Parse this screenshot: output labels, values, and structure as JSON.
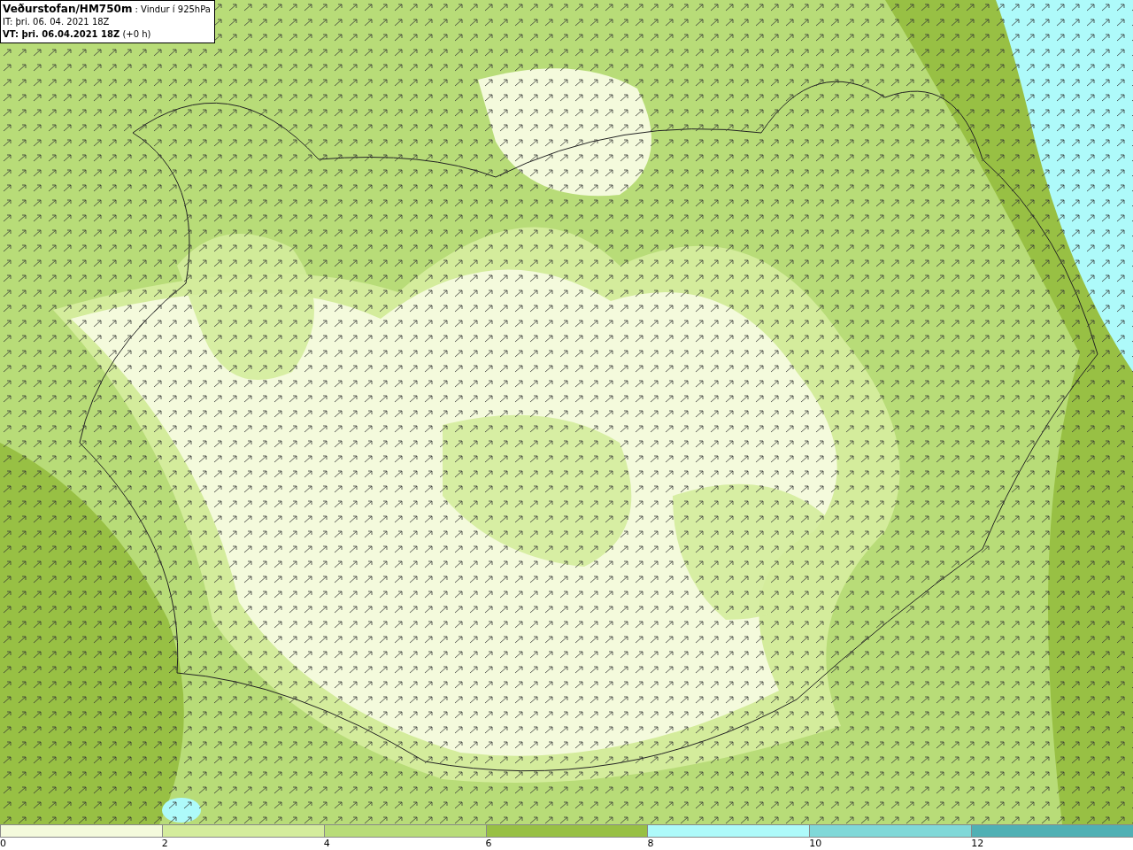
{
  "header": {
    "title": "**Veðurstofan/HM750m** : Vindur í 925hPa",
    "initial_time": "IT: þri. 06. 04. 2021 18Z",
    "valid_time": "**VT: þri. 06.04.2021 18Z** (+0 h)"
  },
  "legend": {
    "bins": [
      {
        "label": "0",
        "color": "#f4fadc"
      },
      {
        "label": "2",
        "color": "#d4ec9c"
      },
      {
        "label": "4",
        "color": "#b8dc78"
      },
      {
        "label": "6",
        "color": "#98c044"
      },
      {
        "label": "8",
        "color": "#aefafa"
      },
      {
        "label": "10",
        "color": "#80d8d8"
      },
      {
        "label": "12",
        "color": "#50b0b4"
      }
    ]
  }
}
